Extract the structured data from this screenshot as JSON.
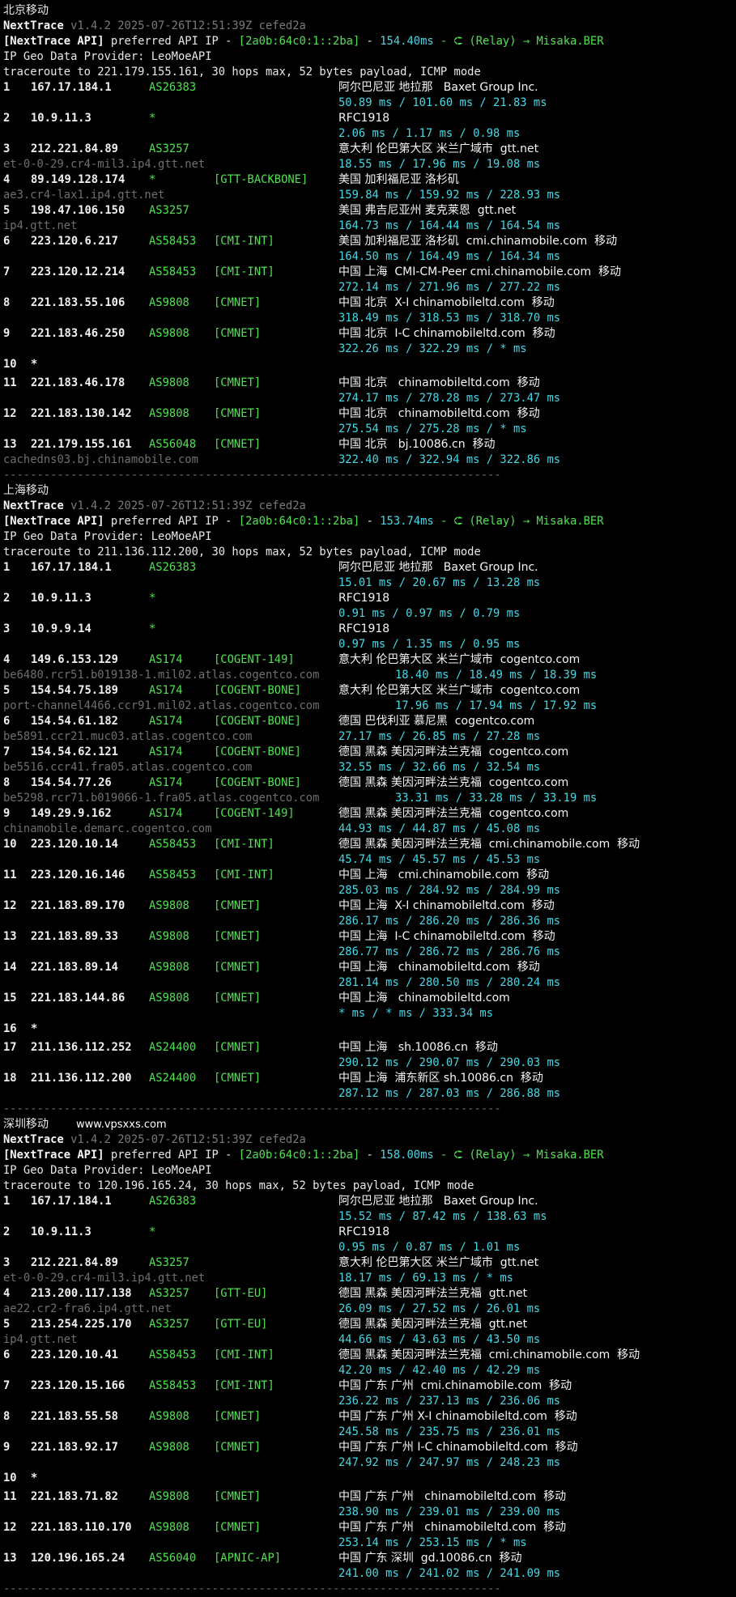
{
  "watermark": "www.vpsxxs.com",
  "separator": "--------------------------------------------------------------------------",
  "sections": [
    {
      "title": "北京移动",
      "header": {
        "app": "NextTrace",
        "version": "v1.4.2 2025-07-26T12:51:39Z cefed2a",
        "api_label": "[NextTrace API]",
        "api_text": "preferred API IP -",
        "api_ip": "[2a0b:64c0:1::2ba]",
        "api_dash": "-",
        "api_ms": "154.40ms",
        "api_relay": "- ⮈ (Relay) → Misaka.BER",
        "geo": "IP Geo Data Provider: LeoMoeAPI",
        "trace": "traceroute to 221.179.155.161, 30 hops max, 52 bytes payload, ICMP mode"
      },
      "hops": [
        {
          "n": "1",
          "ip": "167.17.184.1",
          "as": "AS26383",
          "tag": "",
          "geo": "阿尔巴尼亚 地拉那   Baxet Group Inc.",
          "rtt": "50.89 ms / 101.60 ms / 21.83 ms"
        },
        {
          "n": "2",
          "ip": "10.9.11.3",
          "as": "*",
          "tag": "",
          "geo": "RFC1918",
          "rtt": "2.06 ms / 1.17 ms / 0.98 ms"
        },
        {
          "n": "3",
          "ip": "212.221.84.89",
          "as": "AS3257",
          "tag": "",
          "geo": "意大利 伦巴第大区 米兰广域市  gtt.net",
          "host": "et-0-0-29.cr4-mil3.ip4.gtt.net",
          "rtt": "18.55 ms / 17.96 ms / 19.08 ms"
        },
        {
          "n": "4",
          "ip": "89.149.128.174",
          "as": "*",
          "tag": "[GTT-BACKBONE]",
          "geo": "美国 加利福尼亚 洛杉矶",
          "host": "ae3.cr4-lax1.ip4.gtt.net",
          "rtt": "159.84 ms / 159.92 ms / 228.93 ms"
        },
        {
          "n": "5",
          "ip": "198.47.106.150",
          "as": "AS3257",
          "tag": "",
          "geo": "美国 弗吉尼亚州 麦克莱恩  gtt.net",
          "host": "ip4.gtt.net",
          "rtt": "164.73 ms / 164.44 ms / 164.54 ms"
        },
        {
          "n": "6",
          "ip": "223.120.6.217",
          "as": "AS58453",
          "tag": "[CMI-INT]",
          "geo": "美国 加利福尼亚 洛杉矶  cmi.chinamobile.com  移动",
          "rtt": "164.50 ms / 164.49 ms / 164.34 ms"
        },
        {
          "n": "7",
          "ip": "223.120.12.214",
          "as": "AS58453",
          "tag": "[CMI-INT]",
          "geo": "中国 上海  CMI-CM-Peer cmi.chinamobile.com  移动",
          "rtt": "272.14 ms / 271.96 ms / 277.22 ms"
        },
        {
          "n": "8",
          "ip": "221.183.55.106",
          "as": "AS9808",
          "tag": "[CMNET]",
          "geo": "中国 北京  X-I chinamobileltd.com  移动",
          "rtt": "318.49 ms / 318.53 ms / 318.70 ms"
        },
        {
          "n": "9",
          "ip": "221.183.46.250",
          "as": "AS9808",
          "tag": "[CMNET]",
          "geo": "中国 北京  I-C chinamobileltd.com  移动",
          "rtt": "322.26 ms / 322.29 ms / * ms"
        },
        {
          "n": "10",
          "ip": "*",
          "as": "",
          "tag": "",
          "geo": "",
          "rtt": ""
        },
        {
          "n": "11",
          "ip": "221.183.46.178",
          "as": "AS9808",
          "tag": "[CMNET]",
          "geo": "中国 北京   chinamobileltd.com  移动",
          "rtt": "274.17 ms / 278.28 ms / 273.47 ms"
        },
        {
          "n": "12",
          "ip": "221.183.130.142",
          "as": "AS9808",
          "tag": "[CMNET]",
          "geo": "中国 北京   chinamobileltd.com  移动",
          "rtt": "275.54 ms / 275.28 ms / * ms"
        },
        {
          "n": "13",
          "ip": "221.179.155.161",
          "as": "AS56048",
          "tag": "[CMNET]",
          "geo": "中国 北京   bj.10086.cn  移动",
          "host": "cachedns03.bj.chinamobile.com",
          "rtt": "322.40 ms / 322.94 ms / 322.86 ms"
        }
      ]
    },
    {
      "title": "上海移动",
      "header": {
        "app": "NextTrace",
        "version": "v1.4.2 2025-07-26T12:51:39Z cefed2a",
        "api_label": "[NextTrace API]",
        "api_text": "preferred API IP -",
        "api_ip": "[2a0b:64c0:1::2ba]",
        "api_dash": "-",
        "api_ms": "153.74ms",
        "api_relay": "- ⮈ (Relay) → Misaka.BER",
        "geo": "IP Geo Data Provider: LeoMoeAPI",
        "trace": "traceroute to 211.136.112.200, 30 hops max, 52 bytes payload, ICMP mode"
      },
      "hops": [
        {
          "n": "1",
          "ip": "167.17.184.1",
          "as": "AS26383",
          "tag": "",
          "geo": "阿尔巴尼亚 地拉那   Baxet Group Inc.",
          "rtt": "15.01 ms / 20.67 ms / 13.28 ms"
        },
        {
          "n": "2",
          "ip": "10.9.11.3",
          "as": "*",
          "tag": "",
          "geo": "RFC1918",
          "rtt": "0.91 ms / 0.97 ms / 0.79 ms"
        },
        {
          "n": "3",
          "ip": "10.9.9.14",
          "as": "*",
          "tag": "",
          "geo": "RFC1918",
          "rtt": "0.97 ms / 1.35 ms / 0.95 ms"
        },
        {
          "n": "4",
          "ip": "149.6.153.129",
          "as": "AS174",
          "tag": "[COGENT-149]",
          "geo": "意大利 伦巴第大区 米兰广域市  cogentco.com",
          "host": "be6480.rcr51.b019138-1.mil02.atlas.cogentco.com",
          "rtt": "18.40 ms / 18.49 ms / 18.39 ms"
        },
        {
          "n": "5",
          "ip": "154.54.75.189",
          "as": "AS174",
          "tag": "[COGENT-BONE]",
          "geo": "意大利 伦巴第大区 米兰广域市  cogentco.com",
          "host": "port-channel4466.ccr91.mil02.atlas.cogentco.com",
          "rtt": "17.96 ms / 17.94 ms / 17.92 ms"
        },
        {
          "n": "6",
          "ip": "154.54.61.182",
          "as": "AS174",
          "tag": "[COGENT-BONE]",
          "geo": "德国 巴伐利亚 慕尼黑  cogentco.com",
          "host": "be5891.ccr21.muc03.atlas.cogentco.com",
          "rtt": "27.17 ms / 26.85 ms / 27.28 ms"
        },
        {
          "n": "7",
          "ip": "154.54.62.121",
          "as": "AS174",
          "tag": "[COGENT-BONE]",
          "geo": "德国 黑森 美因河畔法兰克福  cogentco.com",
          "host": "be5516.ccr41.fra05.atlas.cogentco.com",
          "rtt": "32.55 ms / 32.66 ms / 32.54 ms"
        },
        {
          "n": "8",
          "ip": "154.54.77.26",
          "as": "AS174",
          "tag": "[COGENT-BONE]",
          "geo": "德国 黑森 美因河畔法兰克福  cogentco.com",
          "host": "be5298.rcr71.b019066-1.fra05.atlas.cogentco.com",
          "rtt": "33.31 ms / 33.28 ms / 33.19 ms"
        },
        {
          "n": "9",
          "ip": "149.29.9.162",
          "as": "AS174",
          "tag": "[COGENT-149]",
          "geo": "德国 黑森 美因河畔法兰克福  cogentco.com",
          "host": "chinamobile.demarc.cogentco.com",
          "rtt": "44.93 ms / 44.87 ms / 45.08 ms"
        },
        {
          "n": "10",
          "ip": "223.120.10.14",
          "as": "AS58453",
          "tag": "[CMI-INT]",
          "geo": "德国 黑森 美因河畔法兰克福  cmi.chinamobile.com  移动",
          "rtt": "45.74 ms / 45.57 ms / 45.53 ms"
        },
        {
          "n": "11",
          "ip": "223.120.16.146",
          "as": "AS58453",
          "tag": "[CMI-INT]",
          "geo": "中国 上海   cmi.chinamobile.com  移动",
          "rtt": "285.03 ms / 284.92 ms / 284.99 ms"
        },
        {
          "n": "12",
          "ip": "221.183.89.170",
          "as": "AS9808",
          "tag": "[CMNET]",
          "geo": "中国 上海  X-I chinamobileltd.com  移动",
          "rtt": "286.17 ms / 286.20 ms / 286.36 ms"
        },
        {
          "n": "13",
          "ip": "221.183.89.33",
          "as": "AS9808",
          "tag": "[CMNET]",
          "geo": "中国 上海  I-C chinamobileltd.com  移动",
          "rtt": "286.77 ms / 286.72 ms / 286.76 ms"
        },
        {
          "n": "14",
          "ip": "221.183.89.14",
          "as": "AS9808",
          "tag": "[CMNET]",
          "geo": "中国 上海   chinamobileltd.com  移动",
          "rtt": "281.14 ms / 280.50 ms / 280.24 ms"
        },
        {
          "n": "15",
          "ip": "221.183.144.86",
          "as": "AS9808",
          "tag": "[CMNET]",
          "geo": "中国 上海   chinamobileltd.com",
          "rtt": "* ms / * ms / 333.34 ms"
        },
        {
          "n": "16",
          "ip": "*",
          "as": "",
          "tag": "",
          "geo": "",
          "rtt": ""
        },
        {
          "n": "17",
          "ip": "211.136.112.252",
          "as": "AS24400",
          "tag": "[CMNET]",
          "geo": "中国 上海   sh.10086.cn  移动",
          "rtt": "290.12 ms / 290.07 ms / 290.03 ms"
        },
        {
          "n": "18",
          "ip": "211.136.112.200",
          "as": "AS24400",
          "tag": "[CMNET]",
          "geo": "中国 上海  浦东新区 sh.10086.cn  移动",
          "rtt": "287.12 ms / 287.03 ms / 286.88 ms"
        }
      ]
    },
    {
      "title": "深圳移动",
      "header": {
        "app": "NextTrace",
        "version": "v1.4.2 2025-07-26T12:51:39Z cefed2a",
        "api_label": "[NextTrace API]",
        "api_text": "preferred API IP -",
        "api_ip": "[2a0b:64c0:1::2ba]",
        "api_dash": "-",
        "api_ms": "158.00ms",
        "api_relay": "- ⮈ (Relay) → Misaka.BER",
        "geo": "IP Geo Data Provider: LeoMoeAPI",
        "trace": "traceroute to 120.196.165.24, 30 hops max, 52 bytes payload, ICMP mode"
      },
      "hops": [
        {
          "n": "1",
          "ip": "167.17.184.1",
          "as": "AS26383",
          "tag": "",
          "geo": "阿尔巴尼亚 地拉那   Baxet Group Inc.",
          "rtt": "15.52 ms / 87.42 ms / 138.63 ms"
        },
        {
          "n": "2",
          "ip": "10.9.11.3",
          "as": "*",
          "tag": "",
          "geo": "RFC1918",
          "rtt": "0.95 ms / 0.87 ms / 1.01 ms"
        },
        {
          "n": "3",
          "ip": "212.221.84.89",
          "as": "AS3257",
          "tag": "",
          "geo": "意大利 伦巴第大区 米兰广域市  gtt.net",
          "host": "et-0-0-29.cr4-mil3.ip4.gtt.net",
          "rtt": "18.17 ms / 69.13 ms / * ms"
        },
        {
          "n": "4",
          "ip": "213.200.117.138",
          "as": "AS3257",
          "tag": "[GTT-EU]",
          "geo": "德国 黑森 美因河畔法兰克福  gtt.net",
          "host": "ae22.cr2-fra6.ip4.gtt.net",
          "rtt": "26.09 ms / 27.52 ms / 26.01 ms"
        },
        {
          "n": "5",
          "ip": "213.254.225.170",
          "as": "AS3257",
          "tag": "[GTT-EU]",
          "geo": "德国 黑森 美因河畔法兰克福  gtt.net",
          "host": "ip4.gtt.net",
          "rtt": "44.66 ms / 43.63 ms / 43.50 ms"
        },
        {
          "n": "6",
          "ip": "223.120.10.41",
          "as": "AS58453",
          "tag": "[CMI-INT]",
          "geo": "德国 黑森 美因河畔法兰克福  cmi.chinamobile.com  移动",
          "rtt": "42.20 ms / 42.40 ms / 42.29 ms"
        },
        {
          "n": "7",
          "ip": "223.120.15.166",
          "as": "AS58453",
          "tag": "[CMI-INT]",
          "geo": "中国 广东 广州  cmi.chinamobile.com  移动",
          "rtt": "236.22 ms / 237.13 ms / 236.06 ms"
        },
        {
          "n": "8",
          "ip": "221.183.55.58",
          "as": "AS9808",
          "tag": "[CMNET]",
          "geo": "中国 广东 广州 X-I chinamobileltd.com  移动",
          "rtt": "245.58 ms / 235.75 ms / 236.01 ms"
        },
        {
          "n": "9",
          "ip": "221.183.92.17",
          "as": "AS9808",
          "tag": "[CMNET]",
          "geo": "中国 广东 广州 I-C chinamobileltd.com  移动",
          "rtt": "247.92 ms / 247.97 ms / 248.23 ms"
        },
        {
          "n": "10",
          "ip": "*",
          "as": "",
          "tag": "",
          "geo": "",
          "rtt": ""
        },
        {
          "n": "11",
          "ip": "221.183.71.82",
          "as": "AS9808",
          "tag": "[CMNET]",
          "geo": "中国 广东 广州   chinamobileltd.com  移动",
          "rtt": "238.90 ms / 239.01 ms / 239.00 ms"
        },
        {
          "n": "12",
          "ip": "221.183.110.170",
          "as": "AS9808",
          "tag": "[CMNET]",
          "geo": "中国 广东 广州   chinamobileltd.com  移动",
          "rtt": "253.14 ms / 253.15 ms / * ms"
        },
        {
          "n": "13",
          "ip": "120.196.165.24",
          "as": "AS56040",
          "tag": "[APNIC-AP]",
          "geo": "中国 广东 深圳  gd.10086.cn  移动",
          "rtt": "241.00 ms / 241.02 ms / 241.09 ms"
        }
      ]
    }
  ]
}
